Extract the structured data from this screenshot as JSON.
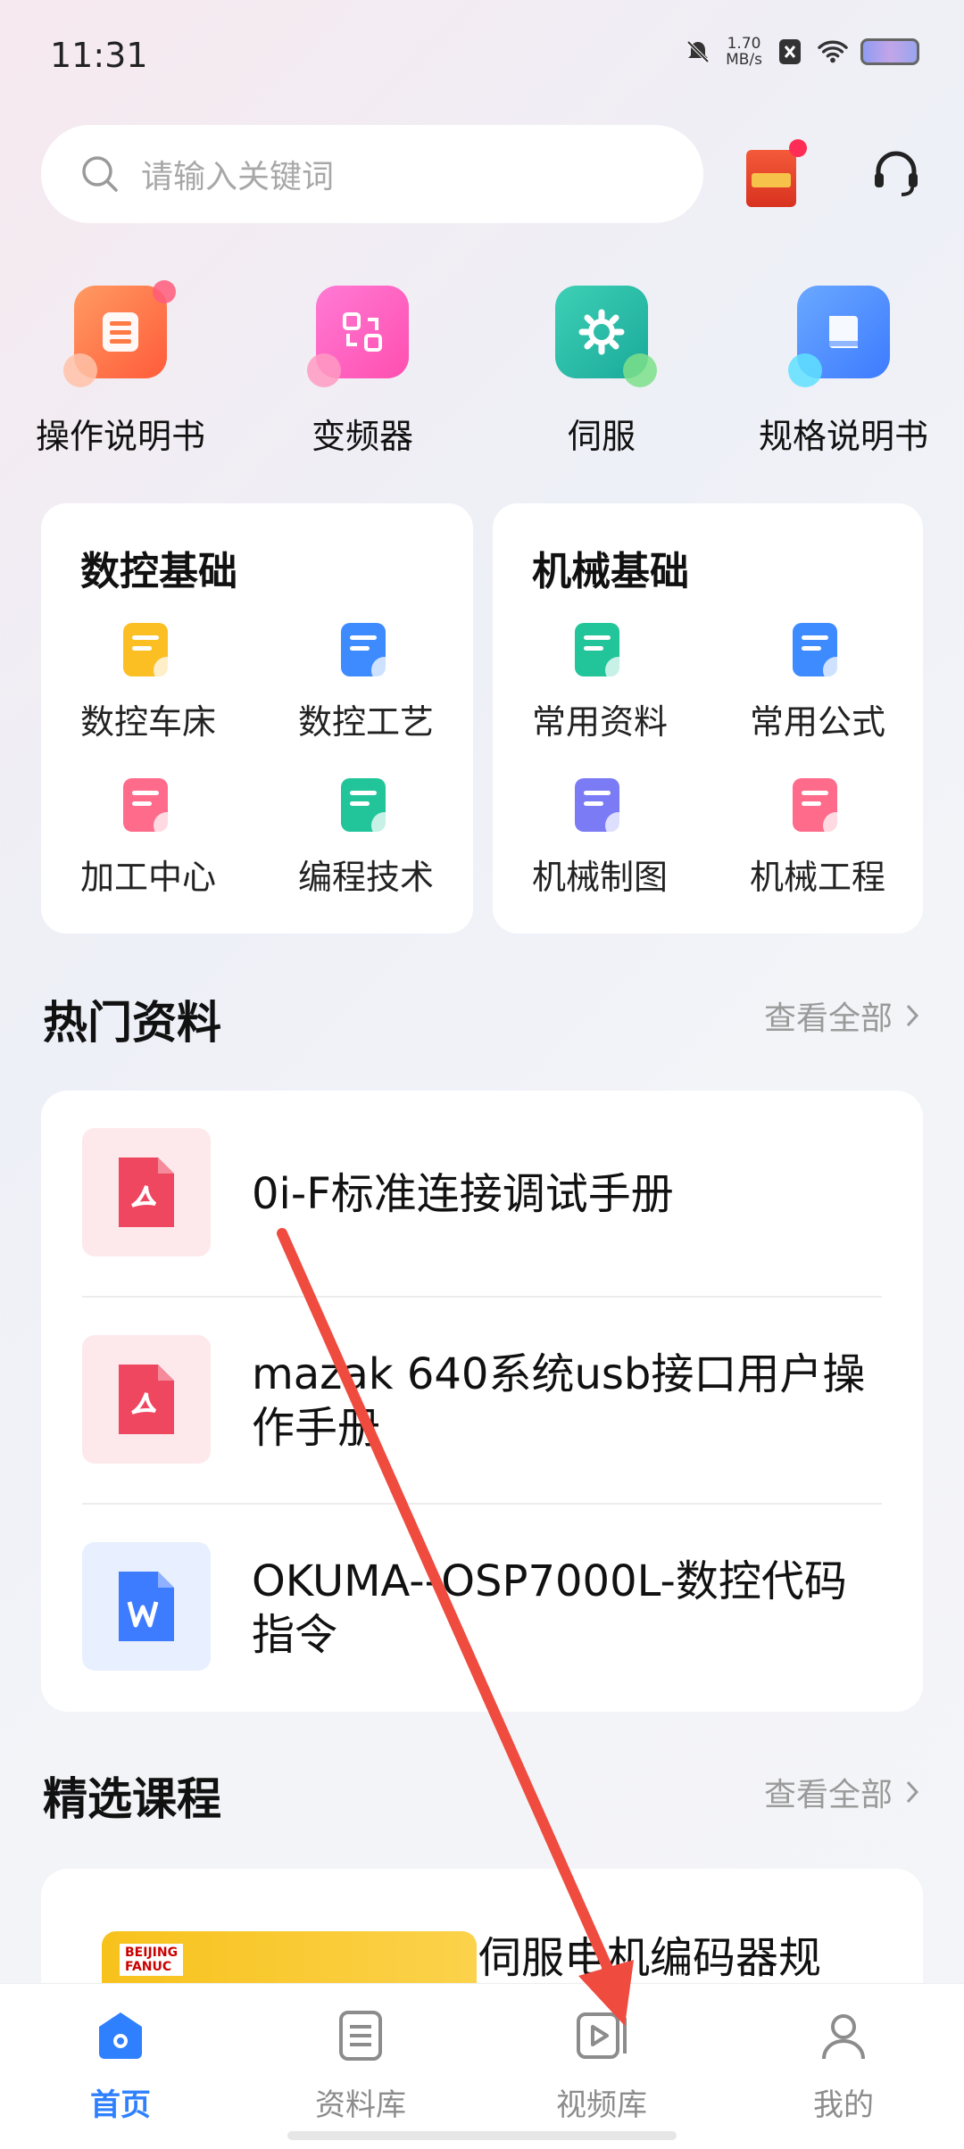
{
  "status_bar": {
    "time": "11:31",
    "net_speed_value": "1.70",
    "net_speed_unit": "MB/s"
  },
  "search": {
    "placeholder": "请输入关键词"
  },
  "quick_categories": [
    {
      "label": "操作说明书",
      "icon": "manual-icon",
      "color": "#ff7a45"
    },
    {
      "label": "变频器",
      "icon": "inverter-icon",
      "color": "#ff5bbd"
    },
    {
      "label": "伺服",
      "icon": "gear-icon",
      "color": "#23c0a8"
    },
    {
      "label": "规格说明书",
      "icon": "book-icon",
      "color": "#3d8bff"
    }
  ],
  "cnc_card": {
    "title": "数控基础",
    "items": [
      {
        "label": "数控车床",
        "icon": "lathe-icon"
      },
      {
        "label": "数控工艺",
        "icon": "process-icon"
      },
      {
        "label": "加工中心",
        "icon": "machining-center-icon"
      },
      {
        "label": "编程技术",
        "icon": "programming-icon"
      }
    ]
  },
  "mech_card": {
    "title": "机械基础",
    "items": [
      {
        "label": "常用资料",
        "icon": "materials-icon"
      },
      {
        "label": "常用公式",
        "icon": "formula-icon"
      },
      {
        "label": "机械制图",
        "icon": "drawing-icon"
      },
      {
        "label": "机械工程",
        "icon": "engineering-icon"
      }
    ]
  },
  "hot": {
    "title": "热门资料",
    "see_all": "查看全部",
    "items": [
      {
        "title": "0i-F标准连接调试手册",
        "type": "pdf-icon"
      },
      {
        "title": "mazak 640系统usb接口用户操作手册",
        "type": "pdf-icon"
      },
      {
        "title": "OKUMA--OSP7000L-数控代码指令",
        "type": "word-icon"
      }
    ]
  },
  "courses": {
    "title": "精选课程",
    "see_all": "查看全部",
    "first_title": "伺服电机编码器规",
    "brand_line1": "BEIJING",
    "brand_line2": "FANUC"
  },
  "nav": [
    {
      "label": "首页",
      "active": true
    },
    {
      "label": "资料库",
      "active": false
    },
    {
      "label": "视频库",
      "active": false
    },
    {
      "label": "我的",
      "active": false
    }
  ],
  "colors": {
    "accent": "#2f80ff",
    "annotation_arrow": "#ef4b3f"
  }
}
